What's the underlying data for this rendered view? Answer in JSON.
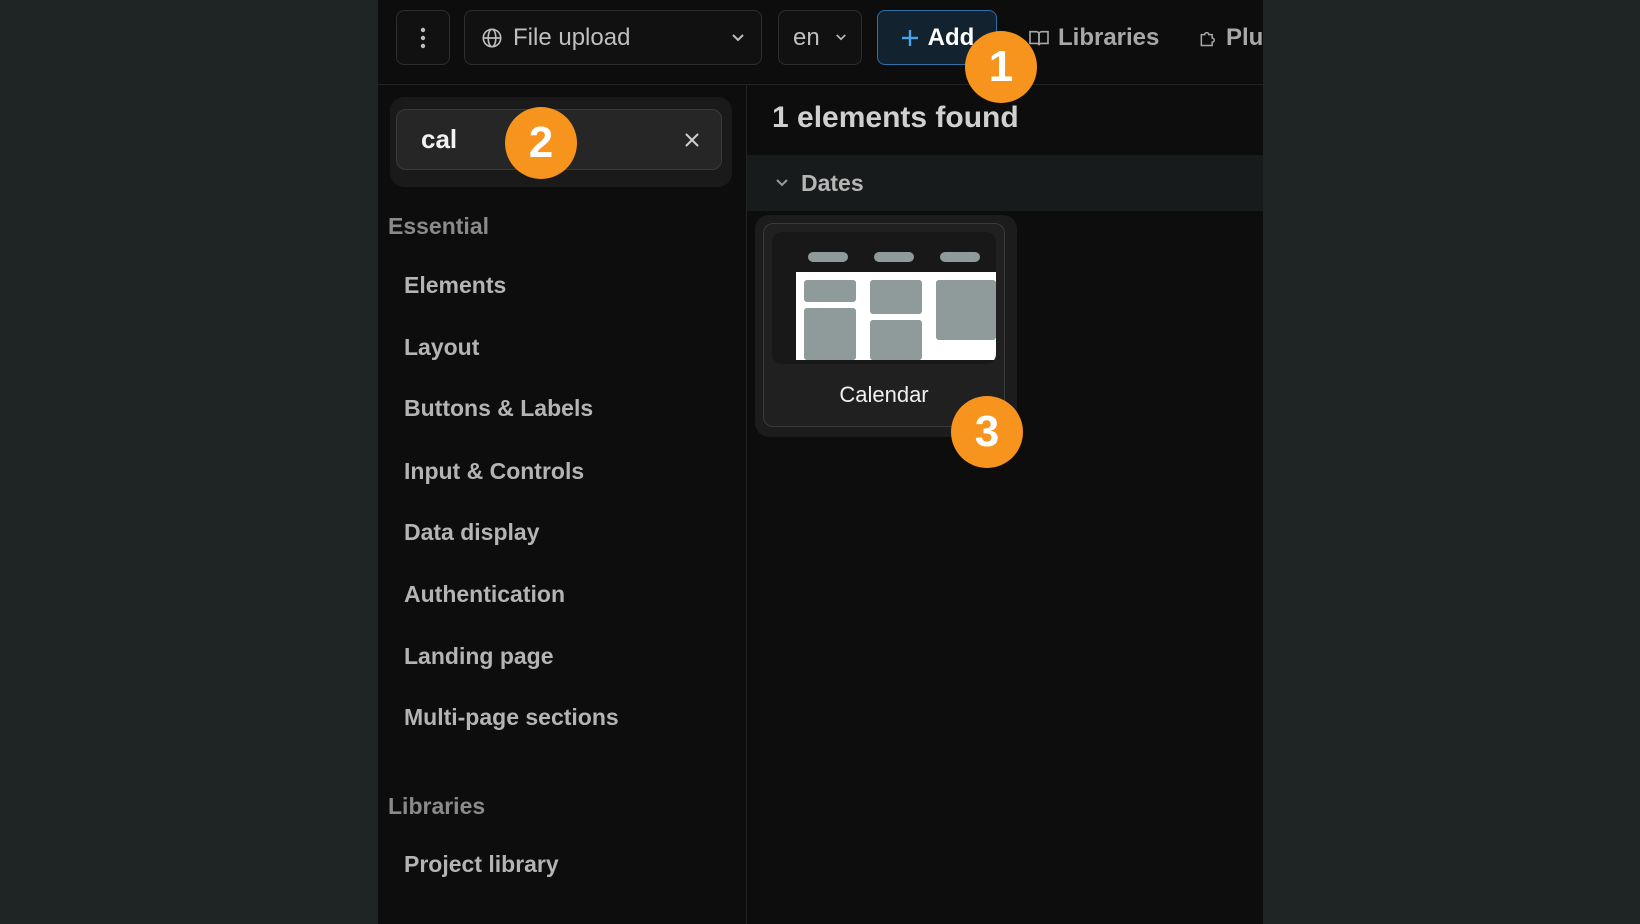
{
  "toolbar": {
    "file_select_label": "File upload",
    "lang_label": "en",
    "add_label": "Add",
    "libraries_label": "Libraries",
    "plugins_label": "Plu"
  },
  "search": {
    "value": "cal"
  },
  "sidebar": {
    "essential_label": "Essential",
    "items": [
      "Elements",
      "Layout",
      "Buttons & Labels",
      "Input & Controls",
      "Data display",
      "Authentication",
      "Landing page",
      "Multi-page sections"
    ],
    "libraries_label": "Libraries",
    "library_items": [
      "Project library"
    ]
  },
  "results": {
    "title": "1 elements found",
    "group_label": "Dates",
    "card_label": "Calendar"
  },
  "badges": {
    "one": "1",
    "two": "2",
    "three": "3"
  },
  "colors": {
    "accent": "#2e6fa8",
    "badge": "#f7941d",
    "background": "#0d0d0d"
  }
}
